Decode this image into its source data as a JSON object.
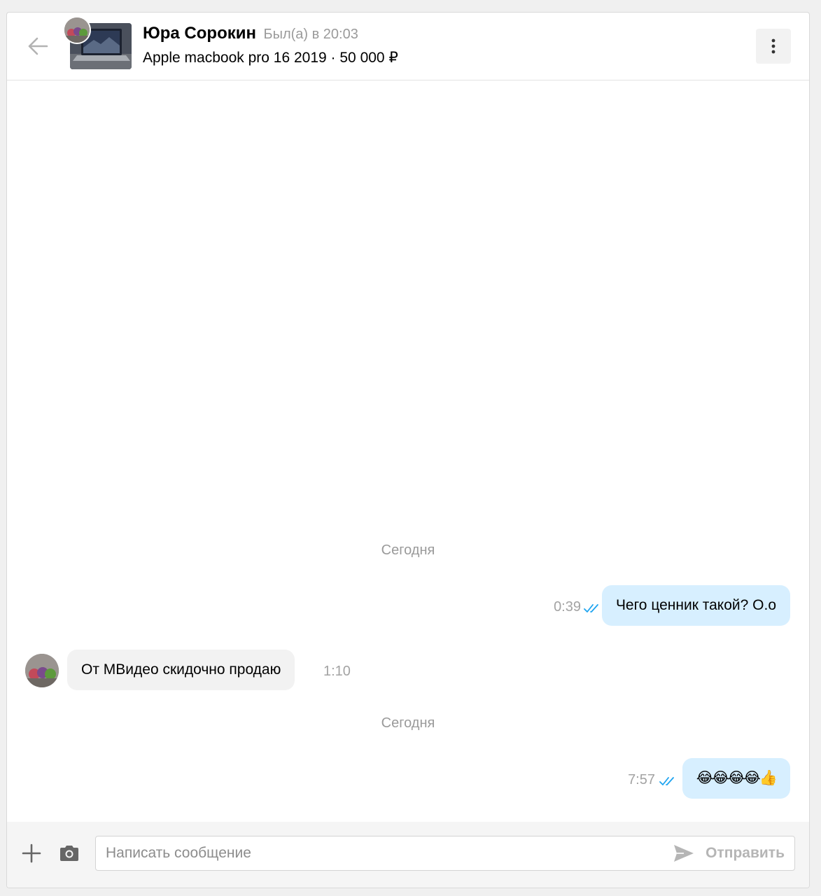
{
  "header": {
    "user_name": "Юра Сорокин",
    "user_status": "Был(а) в 20:03",
    "listing_title": "Apple macbook pro 16 2019",
    "listing_separator": "·",
    "listing_price": "50 000 ₽"
  },
  "messages": [
    {
      "type": "date",
      "text": "Сегодня"
    },
    {
      "type": "out",
      "text": "Чего ценник такой? О.о",
      "time": "0:39",
      "read": true
    },
    {
      "type": "in",
      "text": "От МВидео скидочно продаю",
      "time": "1:10"
    },
    {
      "type": "date",
      "text": "Сегодня"
    },
    {
      "type": "out",
      "text": "😂😂😂😂👍",
      "time": "7:57",
      "read": true
    }
  ],
  "composer": {
    "placeholder": "Написать сообщение",
    "send_label": "Отправить"
  },
  "colors": {
    "outgoing_bubble": "#d7efff",
    "incoming_bubble": "#f2f2f2",
    "read_ticks": "#1ea4f0",
    "muted_text": "#9a9a9a"
  },
  "icons": {
    "back": "arrow-left-icon",
    "menu": "more-vertical-icon",
    "attach": "plus-icon",
    "camera": "camera-icon",
    "send": "send-icon",
    "read": "double-check-icon"
  }
}
